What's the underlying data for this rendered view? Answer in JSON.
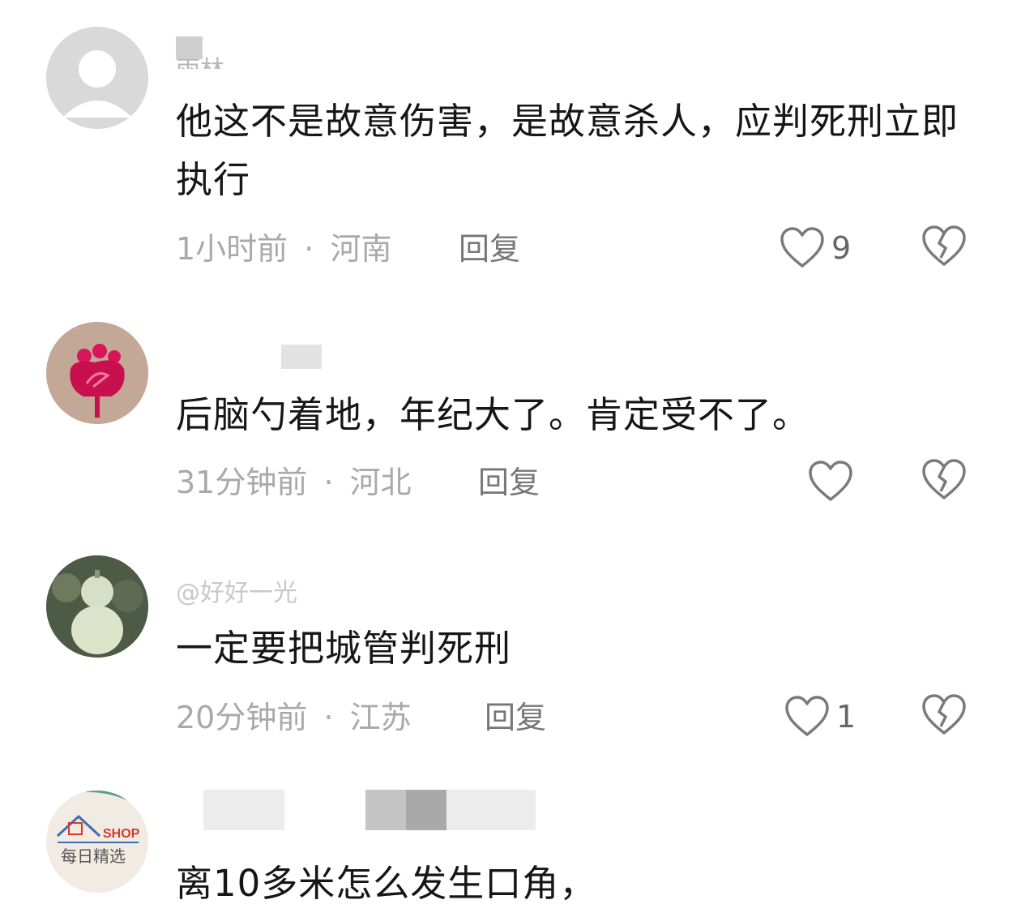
{
  "comments": [
    {
      "username": "雨林",
      "text": "他这不是故意伤害，是故意杀人，应判死刑立即执行",
      "time": "1小时前",
      "location": "河南",
      "reply": "回复",
      "likes": "9",
      "avatar": "default-avatar-icon"
    },
    {
      "username": "",
      "text": "后脑勺着地，年纪大了。肯定受不了。",
      "time": "31分钟前",
      "location": "河北",
      "reply": "回复",
      "likes": "",
      "avatar": "flower-avatar-icon"
    },
    {
      "username": "@好好一光",
      "text": "一定要把城管判死刑",
      "time": "20分钟前",
      "location": "江苏",
      "reply": "回复",
      "likes": "1",
      "avatar": "gourd-avatar-icon"
    },
    {
      "username": "",
      "text": "离10多米怎么发生口角，",
      "avatar": "shop-logo-avatar",
      "avatar_logo_text": "SHOP",
      "avatar_logo_subtext": "每日精选"
    }
  ],
  "separator": "·",
  "colors": {
    "meta": "#a9a9a9",
    "text": "#161616",
    "icon": "#7a7a7a"
  }
}
